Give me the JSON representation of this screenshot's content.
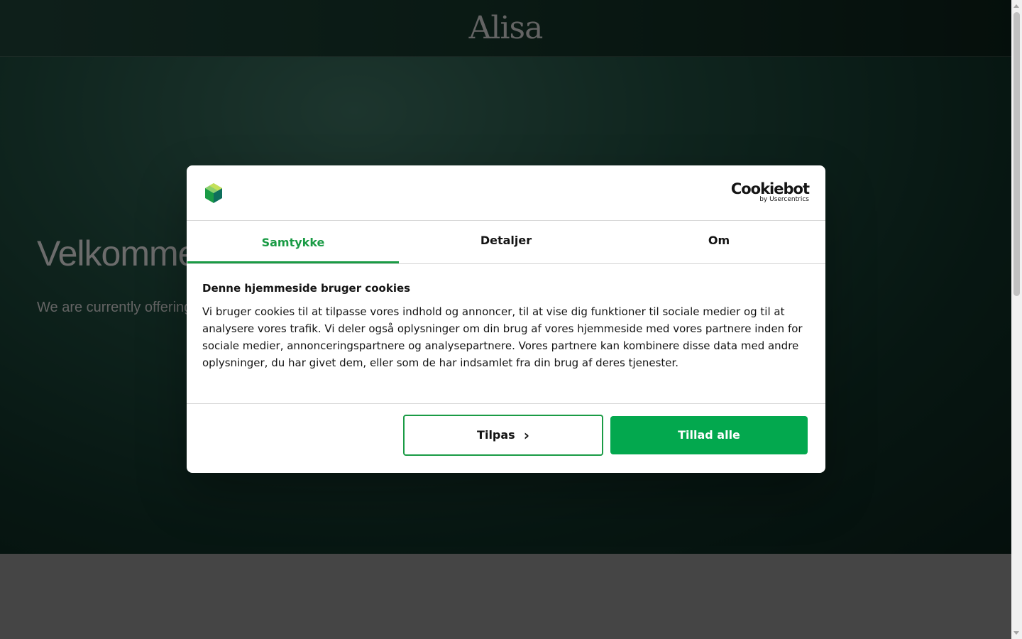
{
  "site": {
    "logo": "Alisa",
    "hero_title": "Velkommen",
    "hero_subtitle": "We are currently offering"
  },
  "dialog": {
    "brand": {
      "name": "Cookiebot",
      "by": "by Usercentrics"
    },
    "tabs": [
      {
        "label": "Samtykke",
        "active": true
      },
      {
        "label": "Detaljer",
        "active": false
      },
      {
        "label": "Om",
        "active": false
      }
    ],
    "heading": "Denne hjemmeside bruger cookies",
    "text": "Vi bruger cookies til at tilpasse vores indhold og annoncer, til at vise dig funktioner til sociale medier og til at analysere vores trafik. Vi deler også oplysninger om din brug af vores hjemmeside med vores partnere inden for sociale medier, annonceringspartnere og analysepartnere. Vores partnere kan kombinere disse data med andre oplysninger, du har givet dem, eller som de har indsamlet fra din brug af deres tjenester.",
    "buttons": {
      "customize": "Tilpas",
      "allow_all": "Tillad alle"
    }
  },
  "colors": {
    "accent": "#1a9b45",
    "allow_button": "#03a84e",
    "hero_dark": "#0f2e25"
  },
  "icons": {
    "cookiebot": "cube-icon",
    "customize_chevron": "chevron-right-icon"
  }
}
